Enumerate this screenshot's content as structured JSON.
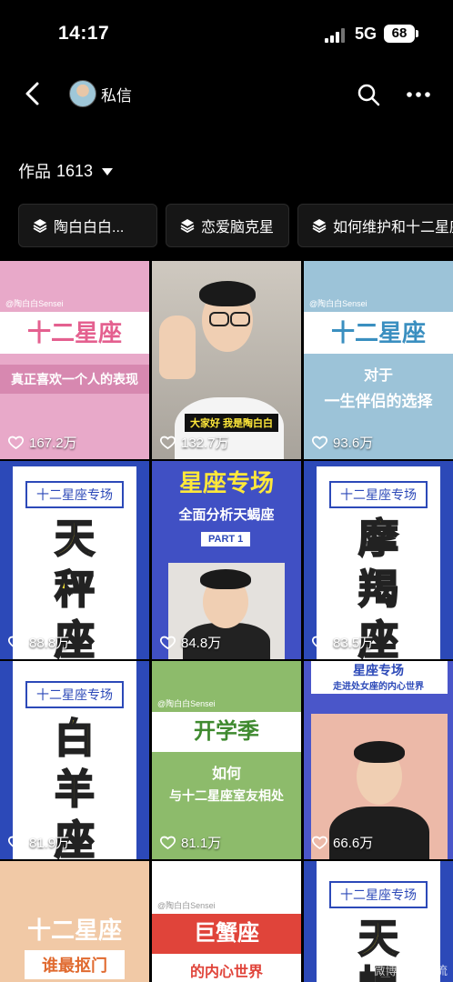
{
  "status": {
    "time": "14:17",
    "network": "5G",
    "battery": "68"
  },
  "nav": {
    "dm_label": "私信"
  },
  "works": {
    "label": "作品",
    "count": "1613"
  },
  "collections": [
    {
      "label": "陶白白白..."
    },
    {
      "label": "恋爱脑克星"
    },
    {
      "label": "如何维护和十二星座"
    }
  ],
  "videos": [
    {
      "likes": "167.2万",
      "title": "十二星座",
      "subtitle": "真正喜欢一个人的表现",
      "credit": "@陶白白Sensei"
    },
    {
      "likes": "132.7万",
      "caption": "大家好 我是陶白白"
    },
    {
      "likes": "93.6万",
      "title": "十二星座",
      "subtitle_line1": "对于",
      "subtitle_line2": "一生伴侣的选择",
      "credit": "@陶白白Sensei"
    },
    {
      "likes": "88.8万",
      "tag": "十二星座专场",
      "chars": [
        "天",
        "秤",
        "座"
      ]
    },
    {
      "likes": "84.8万",
      "title": "星座专场",
      "subtitle": "全面分析天蝎座",
      "part": "PART 1"
    },
    {
      "likes": "83.5万",
      "tag": "十二星座专场",
      "chars": [
        "摩",
        "羯",
        "座"
      ]
    },
    {
      "likes": "81.9万",
      "tag": "十二星座专场",
      "chars": [
        "白",
        "羊",
        "座"
      ]
    },
    {
      "likes": "81.1万",
      "title": "开学季",
      "subtitle_line1": "如何",
      "subtitle_line2": "与十二星座室友相处",
      "credit": "@陶白白Sensei"
    },
    {
      "likes": "66.6万",
      "title": "星座专场",
      "subtitle": "走进处女座的内心世界"
    },
    {
      "title": "十二星座",
      "subtitle": "谁最抠门"
    },
    {
      "title": "巨蟹座",
      "subtitle": "的内心世界",
      "credit": "@陶白白Sensei"
    },
    {
      "tag": "十二星座专场",
      "chars": [
        "天",
        "蝎"
      ]
    }
  ],
  "watermark": "微博 知识风流",
  "colors": {
    "accent_blue": "#2c49b8",
    "yellow": "#ffe83a",
    "pink": "#e8a9c9",
    "green": "#8dbb6b"
  }
}
